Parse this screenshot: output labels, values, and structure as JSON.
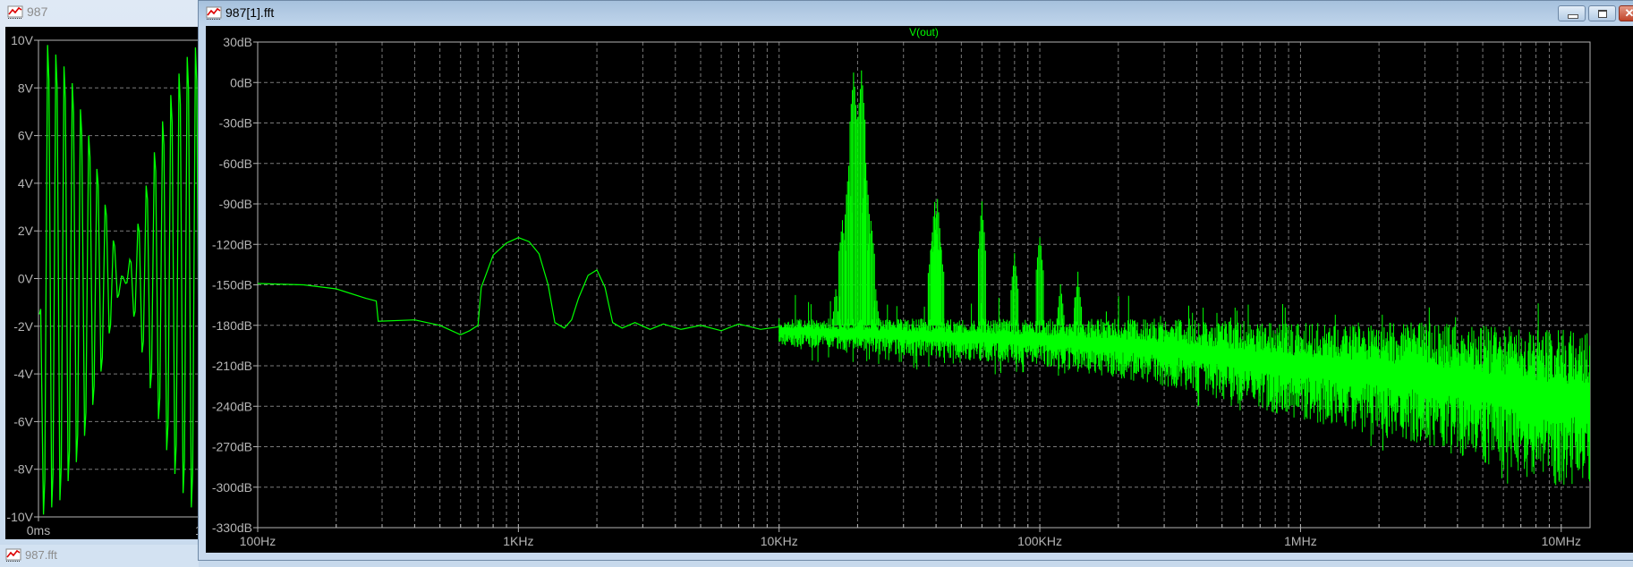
{
  "windows": {
    "wave": {
      "title": "987",
      "icon": "waveform-icon"
    },
    "fft": {
      "title": "987[1].fft",
      "icon": "waveform-icon",
      "buttons": {
        "minimize": "minimize-icon",
        "maximize": "restore-icon",
        "close": "✕"
      }
    },
    "minimized": {
      "title": "987.fft",
      "icon": "waveform-icon"
    }
  },
  "colors": {
    "trace": "#00ff00",
    "background": "#000000",
    "axis": "#b4b4b4",
    "grid": "#7a7a7a"
  },
  "chart_data": [
    {
      "type": "line",
      "title": "",
      "xlabel": "",
      "ylabel": "",
      "x_tick_labels": [
        "0ms",
        "1"
      ],
      "y_tick_labels": [
        "10V",
        "8V",
        "6V",
        "4V",
        "2V",
        "0V",
        "-2V",
        "-4V",
        "-6V",
        "-8V",
        "-10V"
      ],
      "ylim": [
        -10,
        10
      ],
      "grid": true,
      "series": [
        {
          "description_extremes_V": [
            -1.5,
            -9.9,
            9.8,
            -9.6,
            9.4,
            -9.3,
            8.9,
            -8.5,
            8.2,
            -7.7,
            7.1,
            -6.6,
            6.0,
            -5.3,
            4.6,
            -3.9,
            3.1,
            -2.3,
            1.6,
            -0.8,
            0.1,
            -0.2,
            0.8,
            -1.6,
            2.3,
            -3.1,
            3.9,
            -4.6,
            5.3,
            -5.9,
            6.6,
            -7.2,
            7.7,
            -8.2,
            8.6,
            -9.0,
            9.3,
            -9.6,
            9.7,
            -8.2
          ]
        }
      ]
    },
    {
      "type": "line",
      "title": "V(out)",
      "xlabel": "",
      "ylabel": "",
      "x_scale": "log",
      "xlim_hz": [
        100,
        12900000
      ],
      "ylim": [
        -330,
        30
      ],
      "grid": true,
      "x_tick_labels": [
        {
          "hz": 100,
          "label": "100Hz"
        },
        {
          "hz": 1000,
          "label": "1KHz"
        },
        {
          "hz": 10000,
          "label": "10KHz"
        },
        {
          "hz": 100000,
          "label": "100KHz"
        },
        {
          "hz": 1000000,
          "label": "1MHz"
        },
        {
          "hz": 10000000,
          "label": "10MHz"
        }
      ],
      "y_tick_labels": [
        "30dB",
        "0dB",
        "-30dB",
        "-60dB",
        "-90dB",
        "-120dB",
        "-150dB",
        "-180dB",
        "-210dB",
        "-240dB",
        "-270dB",
        "-300dB",
        "-330dB"
      ],
      "series": [
        {
          "name": "V(out)",
          "low_freq_curve": [
            [
              100,
              -149
            ],
            [
              150,
              -150
            ],
            [
              200,
              -153
            ],
            [
              260,
              -160
            ],
            [
              285,
              -162
            ],
            [
              290,
              -177
            ],
            [
              400,
              -176
            ],
            [
              500,
              -180
            ],
            [
              600,
              -187
            ],
            [
              650,
              -184
            ],
            [
              700,
              -180
            ],
            [
              720,
              -152
            ],
            [
              800,
              -128
            ],
            [
              900,
              -119
            ],
            [
              1000,
              -115
            ],
            [
              1100,
              -118
            ],
            [
              1200,
              -127
            ],
            [
              1300,
              -150
            ],
            [
              1380,
              -178
            ],
            [
              1500,
              -182
            ],
            [
              1600,
              -176
            ],
            [
              1700,
              -160
            ],
            [
              1850,
              -143
            ],
            [
              2000,
              -139
            ],
            [
              2150,
              -152
            ],
            [
              2300,
              -178
            ],
            [
              2500,
              -182
            ],
            [
              2800,
              -178
            ],
            [
              3200,
              -183
            ],
            [
              3600,
              -179
            ],
            [
              4200,
              -183
            ],
            [
              5000,
              -180
            ],
            [
              6000,
              -184
            ],
            [
              7000,
              -179
            ],
            [
              8500,
              -183
            ],
            [
              10000,
              -181
            ]
          ],
          "peaks": [
            {
              "hz": 16500,
              "db": -150
            },
            {
              "hz": 17500,
              "db": -100
            },
            {
              "hz": 18500,
              "db": -58
            },
            {
              "hz": 19300,
              "db": 10
            },
            {
              "hz": 20700,
              "db": 11
            },
            {
              "hz": 21500,
              "db": -59
            },
            {
              "hz": 22500,
              "db": -100
            },
            {
              "hz": 23500,
              "db": -150
            },
            {
              "hz": 38500,
              "db": -115
            },
            {
              "hz": 39500,
              "db": -85
            },
            {
              "hz": 40500,
              "db": -83
            },
            {
              "hz": 41500,
              "db": -115
            },
            {
              "hz": 60000,
              "db": -86
            },
            {
              "hz": 80000,
              "db": -126
            },
            {
              "hz": 100000,
              "db": -112
            },
            {
              "hz": 120000,
              "db": -147
            },
            {
              "hz": 140000,
              "db": -140
            },
            {
              "hz": 180000,
              "db": -167
            }
          ],
          "noise_band": [
            {
              "hz": 10000,
              "top": -175,
              "bottom": -195
            },
            {
              "hz": 100000,
              "top": -175,
              "bottom": -210
            },
            {
              "hz": 300000,
              "top": -175,
              "bottom": -225
            },
            {
              "hz": 1000000,
              "top": -178,
              "bottom": -250
            },
            {
              "hz": 3000000,
              "top": -178,
              "bottom": -270
            },
            {
              "hz": 10000000,
              "top": -182,
              "bottom": -300
            },
            {
              "hz": 12900000,
              "top": -185,
              "bottom": -300
            }
          ]
        }
      ]
    }
  ]
}
